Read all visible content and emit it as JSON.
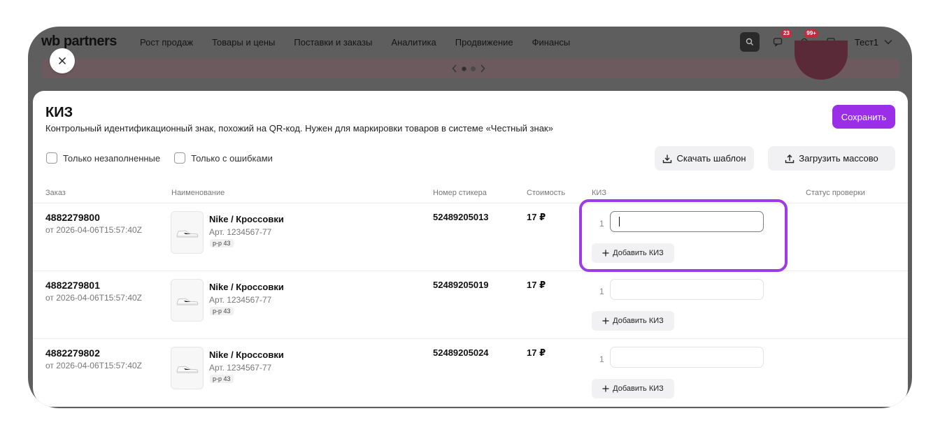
{
  "brand": {
    "logo": "wb partners"
  },
  "nav": {
    "items": [
      "Рост продаж",
      "Товары и цены",
      "Поставки и заказы",
      "Аналитика",
      "Продвижение",
      "Финансы"
    ]
  },
  "topbar": {
    "chat_badge": "23",
    "notif_badge": "99+",
    "user": "Тест1"
  },
  "modal": {
    "title": "КИЗ",
    "subtitle": "Контрольный идентификационный знак, похожий на QR-код. Нужен для маркировки товаров в системе «Честный знак»",
    "save_label": "Сохранить",
    "filter_unfilled": "Только незаполненные",
    "filter_errors": "Только с ошибками",
    "download_label": "Скачать шаблон",
    "upload_label": "Загрузить массово"
  },
  "table": {
    "columns": {
      "order": "Заказ",
      "name": "Наименование",
      "sticker": "Номер стикера",
      "price": "Стоимость",
      "kiz": "КИЗ",
      "status": "Статус проверки"
    },
    "rows": [
      {
        "order": "4882279800",
        "date": "от 2026-04-06T15:57:40Z",
        "name": "Nike / Кроссовки",
        "art": "Арт. 1234567-77",
        "size": "р-р 43",
        "sticker": "52489205013",
        "price": "17 ₽",
        "kiz_index": "1",
        "add_kiz": "Добавить КИЗ"
      },
      {
        "order": "4882279801",
        "date": "от 2026-04-06T15:57:40Z",
        "name": "Nike / Кроссовки",
        "art": "Арт. 1234567-77",
        "size": "р-р 43",
        "sticker": "52489205019",
        "price": "17 ₽",
        "kiz_index": "1",
        "add_kiz": "Добавить КИЗ"
      },
      {
        "order": "4882279802",
        "date": "от 2026-04-06T15:57:40Z",
        "name": "Nike / Кроссовки",
        "art": "Арт. 1234567-77",
        "size": "р-р 43",
        "sticker": "52489205024",
        "price": "17 ₽",
        "kiz_index": "1",
        "add_kiz": "Добавить КИЗ"
      }
    ]
  },
  "colors": {
    "accent": "#9b2fe8",
    "highlight": "#9f3be6",
    "overlay": "#5e5e5e"
  }
}
